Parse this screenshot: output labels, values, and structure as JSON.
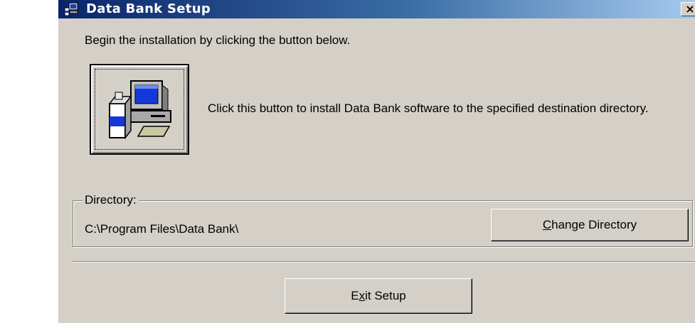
{
  "window": {
    "title": "Data Bank Setup",
    "close_label": "×"
  },
  "intro_text": "Begin the installation by clicking the button below.",
  "install": {
    "description": "Click this button to install Data Bank software to the specified destination directory."
  },
  "directory": {
    "label": "Directory:",
    "path": "C:\\Program Files\\Data Bank\\",
    "change_button": {
      "mnemonic": "C",
      "rest": "hange Directory"
    }
  },
  "exit_button": {
    "before": "E",
    "mnemonic": "x",
    "after": "it Setup"
  },
  "icons": {
    "title_icon": "setup-computer-icon",
    "install_icon": "computer-install-icon",
    "close_icon": "close-icon"
  },
  "colors": {
    "title_bar_start": "#0a246a",
    "title_bar_end": "#a6caf0",
    "face": "#d4d0c8"
  }
}
